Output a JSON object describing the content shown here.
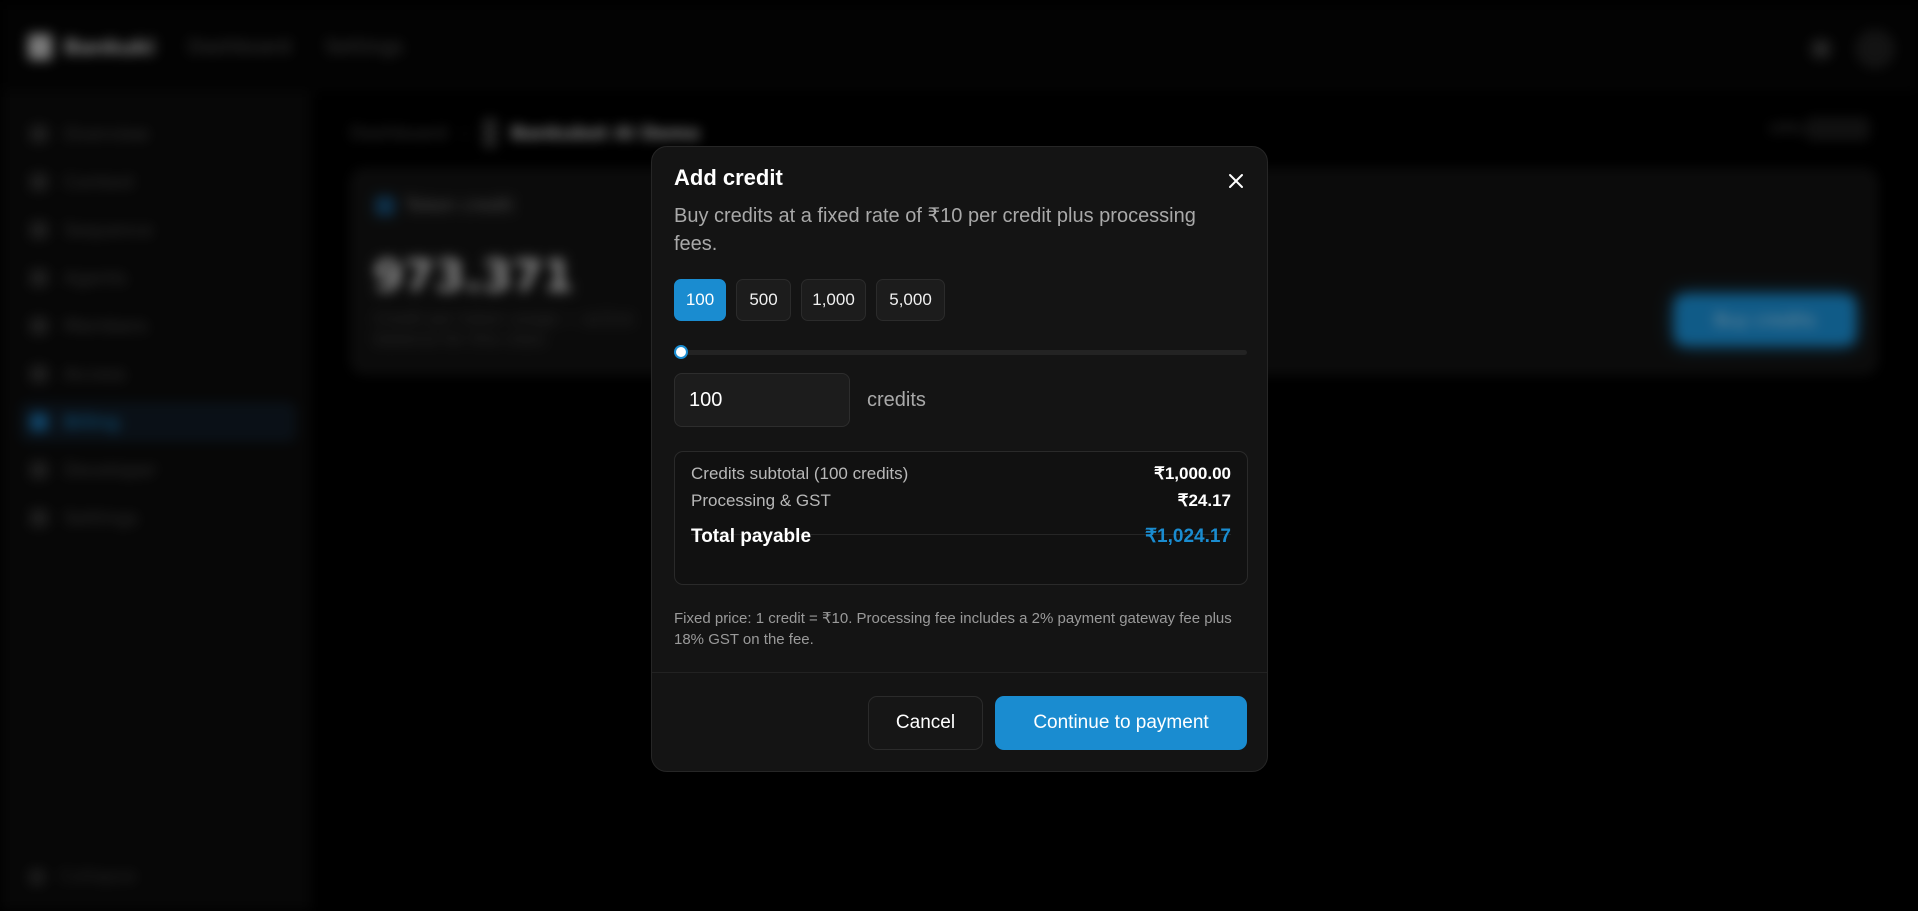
{
  "app": {
    "brand": "Bankuki",
    "nav": [
      "Dashboard",
      "Settings"
    ]
  },
  "sidebar": {
    "items": [
      {
        "label": "Overview"
      },
      {
        "label": "Context"
      },
      {
        "label": "Sequence"
      },
      {
        "label": "Agents"
      },
      {
        "label": "Members"
      },
      {
        "label": "Access"
      },
      {
        "label": "Billing"
      },
      {
        "label": "Developer"
      },
      {
        "label": "Settings"
      }
    ],
    "active_index": 6,
    "collapse_label": "Collapse"
  },
  "breadcrumb": {
    "root": "Dashboard",
    "separator": "›",
    "current": "Bankubot AI Demo"
  },
  "header_status": "Offline",
  "credit_card": {
    "title": "Token credit",
    "value": "973.371",
    "note": "Credit per token usage — active balance for this class",
    "button": "Buy credits"
  },
  "modal": {
    "title": "Add credit",
    "description": "Buy credits at a fixed rate of ₹10 per credit plus processing fees.",
    "presets": [
      "100",
      "500",
      "1,000",
      "5,000"
    ],
    "selected_preset_index": 0,
    "slider": {
      "value": 100,
      "min": 100,
      "max": 100000
    },
    "amount_value": "100",
    "amount_unit": "credits",
    "summary": {
      "subtotal_label": "Credits subtotal (100 credits)",
      "subtotal_value": "₹1,000.00",
      "fees_label": "Processing & GST",
      "fees_value": "₹24.17",
      "total_label": "Total payable",
      "total_value": "₹1,024.17"
    },
    "fine_print": "Fixed price: 1 credit = ₹10. Processing fee includes a 2% payment gateway fee plus 18% GST on the fee.",
    "cancel_label": "Cancel",
    "continue_label": "Continue to payment"
  },
  "colors": {
    "accent": "#1a8cd0",
    "background": "#000000",
    "modal_bg": "#141414"
  },
  "icons": {
    "close": "close-icon",
    "bell": "bell-icon",
    "logo": "logo-icon"
  }
}
